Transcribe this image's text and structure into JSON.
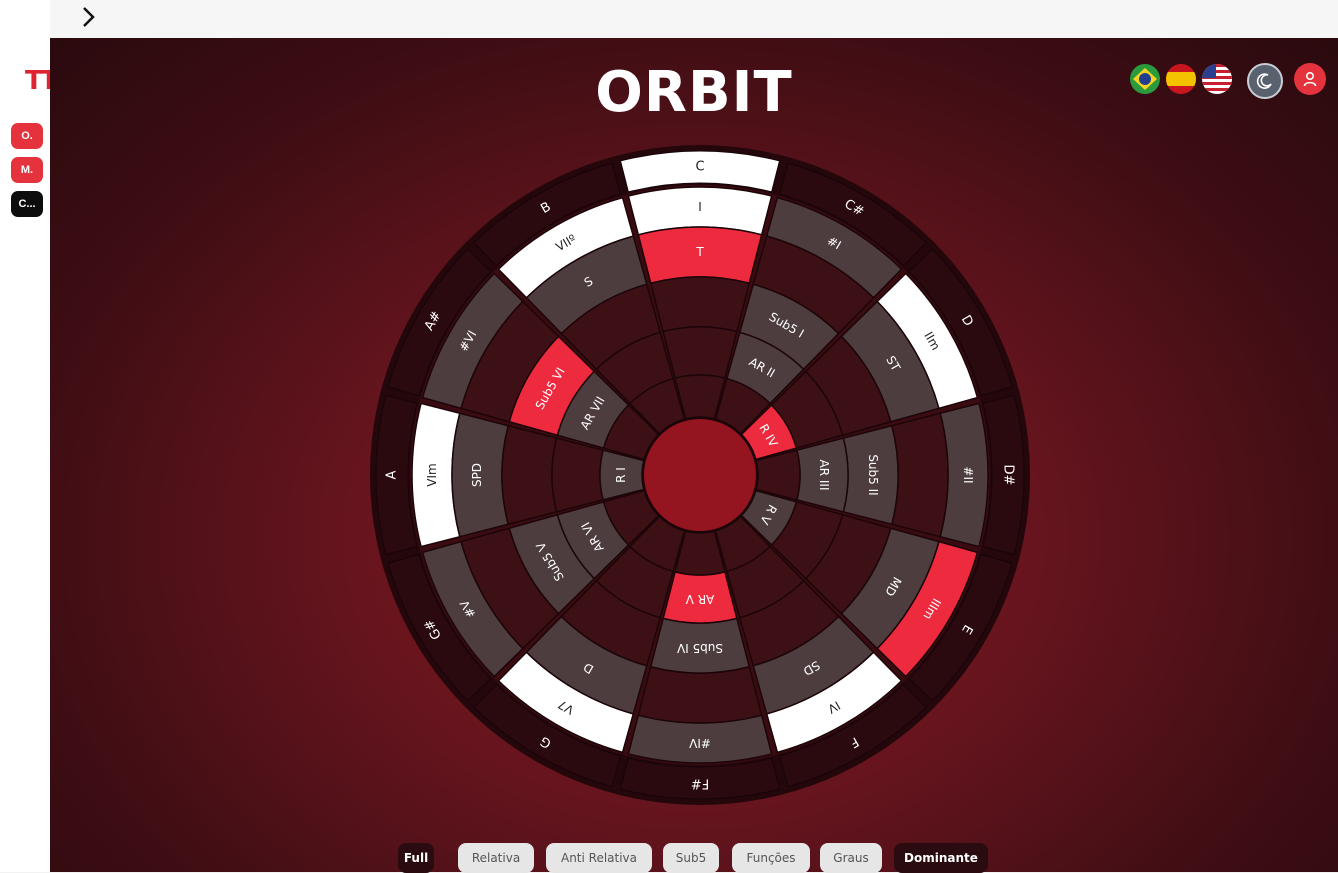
{
  "app": {
    "title": "ORBIT",
    "logo_text": "TT"
  },
  "sidebar": {
    "items": [
      {
        "label": "O.",
        "color": "#e4333d"
      },
      {
        "label": "M.",
        "color": "#e4333d"
      },
      {
        "label": "C...",
        "color": "#0c0c0c"
      }
    ]
  },
  "header": {
    "flags": [
      "brazil-flag-icon",
      "spain-flag-icon",
      "usa-flag-icon"
    ],
    "theme_icon": "moon-icon",
    "user_icon": "user-icon"
  },
  "colors": {
    "active_red": "#ee2a3e",
    "white": "#ffffff",
    "gray": "#4e3d3f",
    "dark_wine": "#3d1016",
    "darker_wine": "#2f0a0f",
    "center": "#94141f"
  },
  "wheel": {
    "notes": [
      "C",
      "C#",
      "D",
      "D#",
      "E",
      "F",
      "F#",
      "G",
      "G#",
      "A",
      "A#",
      "B"
    ],
    "degrees": [
      "I",
      "#I",
      "IIm",
      "#II",
      "IIIm",
      "IV",
      "#IV",
      "V7",
      "#V",
      "VIm",
      "#VI",
      "VIIº"
    ],
    "functions": [
      "T",
      "",
      "ST",
      "",
      "MD",
      "SD",
      "",
      "D",
      "",
      "SPD",
      "",
      "S"
    ],
    "subs": [
      "",
      "Sub5 I",
      "",
      "Sub5 II",
      "",
      "",
      "Sub5 IV",
      "",
      "Sub5 V",
      "",
      "Sub5 VI",
      ""
    ],
    "ar": [
      "",
      "AR II",
      "",
      "AR III",
      "",
      "",
      "AR V",
      "",
      "AR VI",
      "",
      "AR VII",
      ""
    ],
    "r": [
      "",
      "",
      "R IV",
      "",
      "R V",
      "",
      "",
      "",
      "",
      "R I",
      "",
      ""
    ],
    "degree_colors": [
      "white",
      "gray",
      "white",
      "gray",
      "red",
      "white",
      "gray",
      "white",
      "gray",
      "white",
      "gray",
      "white"
    ],
    "function_colors": [
      "red",
      "dark",
      "gray",
      "dark",
      "gray",
      "gray",
      "dark",
      "gray",
      "dark",
      "gray",
      "dark",
      "gray"
    ],
    "sub_colors": [
      "dark",
      "gray",
      "dark",
      "gray",
      "dark",
      "dark",
      "gray",
      "dark",
      "gray",
      "dark",
      "red",
      "dark"
    ],
    "ar_colors": [
      "dark",
      "gray",
      "dark",
      "gray",
      "dark",
      "dark",
      "red",
      "dark",
      "gray",
      "dark",
      "gray",
      "dark"
    ],
    "r_colors": [
      "dark",
      "dark",
      "red",
      "dark",
      "gray",
      "dark",
      "dark",
      "dark",
      "dark",
      "gray",
      "dark",
      "dark"
    ],
    "active_note": "C"
  },
  "tabs": [
    {
      "label": "Full",
      "style": "dark"
    },
    {
      "label": "Relativa",
      "style": "light"
    },
    {
      "label": "Anti Relativa",
      "style": "light"
    },
    {
      "label": "Sub5",
      "style": "light"
    },
    {
      "label": "Funções",
      "style": "light"
    },
    {
      "label": "Graus",
      "style": "light"
    },
    {
      "label": "Dominante",
      "style": "dark"
    }
  ]
}
